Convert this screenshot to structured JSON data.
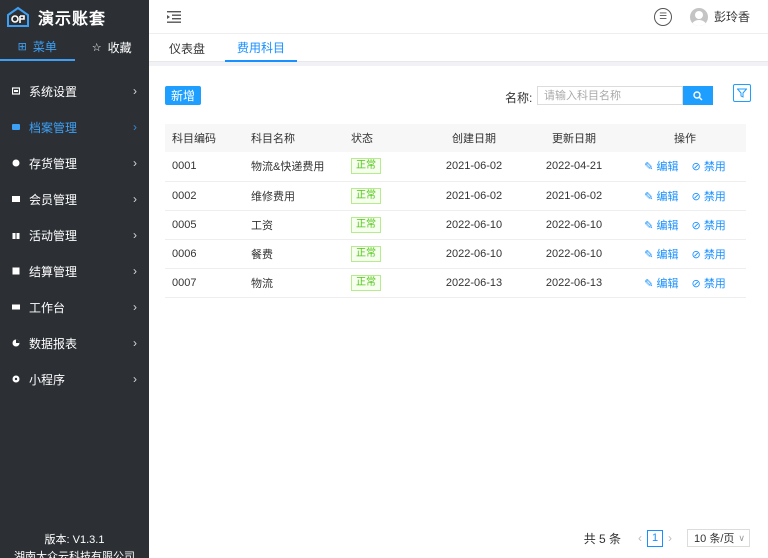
{
  "app": {
    "title": "演示账套"
  },
  "sidebar": {
    "tabs": [
      {
        "label": "菜单",
        "icon": "grid-icon"
      },
      {
        "label": "收藏",
        "icon": "star-icon"
      }
    ],
    "items": [
      {
        "label": "系统设置",
        "icon": "settings-icon"
      },
      {
        "label": "档案管理",
        "icon": "archive-icon",
        "active": true
      },
      {
        "label": "存货管理",
        "icon": "inventory-icon"
      },
      {
        "label": "会员管理",
        "icon": "member-icon"
      },
      {
        "label": "活动管理",
        "icon": "gift-icon"
      },
      {
        "label": "结算管理",
        "icon": "settlement-icon"
      },
      {
        "label": "工作台",
        "icon": "workbench-icon"
      },
      {
        "label": "数据报表",
        "icon": "report-icon"
      },
      {
        "label": "小程序",
        "icon": "miniprogram-icon"
      }
    ],
    "version": "版本: V1.3.1",
    "company": "湖南大众云科技有限公司"
  },
  "header": {
    "username": "彭玲香"
  },
  "page_tabs": [
    {
      "label": "仪表盘"
    },
    {
      "label": "费用科目",
      "active": true
    }
  ],
  "toolbar": {
    "new_label": "新增",
    "search_label": "名称:",
    "search_placeholder": "请输入科目名称",
    "search_value": ""
  },
  "table": {
    "headers": [
      "科目编码",
      "科目名称",
      "状态",
      "创建日期",
      "更新日期",
      "操作"
    ],
    "rows": [
      {
        "code": "0001",
        "name": "物流&快递费用",
        "status": "正常",
        "created": "2021-06-02",
        "updated": "2022-04-21"
      },
      {
        "code": "0002",
        "name": "维修费用",
        "status": "正常",
        "created": "2021-06-02",
        "updated": "2021-06-02"
      },
      {
        "code": "0005",
        "name": "工资",
        "status": "正常",
        "created": "2022-06-10",
        "updated": "2022-06-10"
      },
      {
        "code": "0006",
        "name": "餐费",
        "status": "正常",
        "created": "2022-06-10",
        "updated": "2022-06-10"
      },
      {
        "code": "0007",
        "name": "物流",
        "status": "正常",
        "created": "2022-06-13",
        "updated": "2022-06-13"
      }
    ],
    "edit_label": "编辑",
    "disable_label": "禁用"
  },
  "pagination": {
    "total": "共 5 条",
    "current": "1",
    "page_size": "10 条/页"
  },
  "colors": {
    "accent": "#1890ff",
    "sidebar_bg": "#2c3035",
    "status_green": "#52c41a"
  }
}
